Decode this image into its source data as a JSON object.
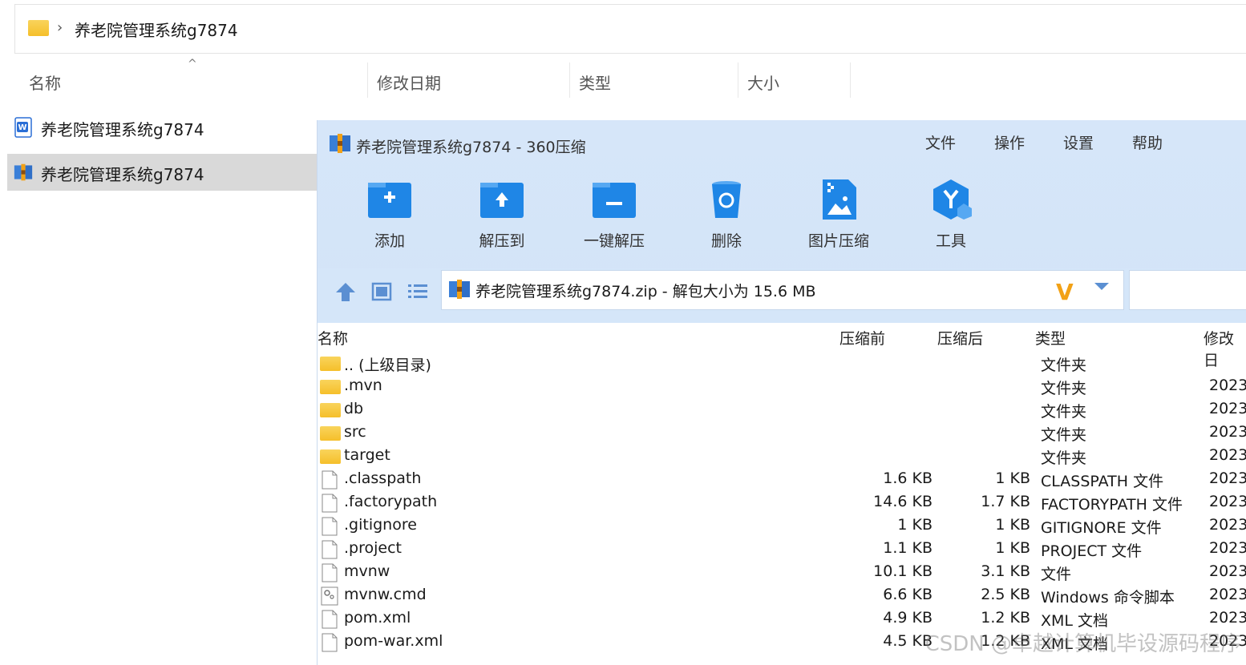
{
  "explorer": {
    "path": "养老院管理系统g7874",
    "columns": [
      "名称",
      "修改日期",
      "类型",
      "大小"
    ],
    "files": [
      {
        "name": "养老院管理系统g7874",
        "icon": "word-doc-icon",
        "selected": false
      },
      {
        "name": "养老院管理系统g7874",
        "icon": "zip-archive-icon",
        "selected": true
      }
    ]
  },
  "zip": {
    "title": "养老院管理系统g7874 - 360压缩",
    "menu": [
      "文件",
      "操作",
      "设置",
      "帮助"
    ],
    "tools": [
      "添加",
      "解压到",
      "一键解压",
      "删除",
      "图片压缩",
      "工具"
    ],
    "path_text": "养老院管理系统g7874.zip - 解包大小为 15.6 MB",
    "columns": [
      "名称",
      "压缩前",
      "压缩后",
      "类型",
      "修改日"
    ],
    "rows": [
      {
        "name": ".. (上级目录)",
        "before": "",
        "after": "",
        "type": "文件夹",
        "date": "",
        "kind": "folder"
      },
      {
        "name": ".mvn",
        "before": "",
        "after": "",
        "type": "文件夹",
        "date": "2023-",
        "kind": "folder"
      },
      {
        "name": "db",
        "before": "",
        "after": "",
        "type": "文件夹",
        "date": "2023-",
        "kind": "folder"
      },
      {
        "name": "src",
        "before": "",
        "after": "",
        "type": "文件夹",
        "date": "2023-",
        "kind": "folder"
      },
      {
        "name": "target",
        "before": "",
        "after": "",
        "type": "文件夹",
        "date": "2023-",
        "kind": "folder"
      },
      {
        "name": ".classpath",
        "before": "1.6 KB",
        "after": "1 KB",
        "type": "CLASSPATH 文件",
        "date": "2023-",
        "kind": "file"
      },
      {
        "name": ".factorypath",
        "before": "14.6 KB",
        "after": "1.7 KB",
        "type": "FACTORYPATH 文件",
        "date": "2023-",
        "kind": "file"
      },
      {
        "name": ".gitignore",
        "before": "1 KB",
        "after": "1 KB",
        "type": "GITIGNORE 文件",
        "date": "2023-",
        "kind": "file"
      },
      {
        "name": ".project",
        "before": "1.1 KB",
        "after": "1 KB",
        "type": "PROJECT 文件",
        "date": "2023-",
        "kind": "file"
      },
      {
        "name": "mvnw",
        "before": "10.1 KB",
        "after": "3.1 KB",
        "type": "文件",
        "date": "2023-",
        "kind": "file"
      },
      {
        "name": "mvnw.cmd",
        "before": "6.6 KB",
        "after": "2.5 KB",
        "type": "Windows 命令脚本",
        "date": "2023-",
        "kind": "cmd"
      },
      {
        "name": "pom.xml",
        "before": "4.9 KB",
        "after": "1.2 KB",
        "type": "XML 文档",
        "date": "2023-",
        "kind": "file"
      },
      {
        "name": "pom-war.xml",
        "before": "4.5 KB",
        "after": "1.2 KB",
        "type": "XML 文档",
        "date": "2023",
        "kind": "file"
      }
    ]
  },
  "watermark": "CSDN @卓越计算机毕设源码程序"
}
